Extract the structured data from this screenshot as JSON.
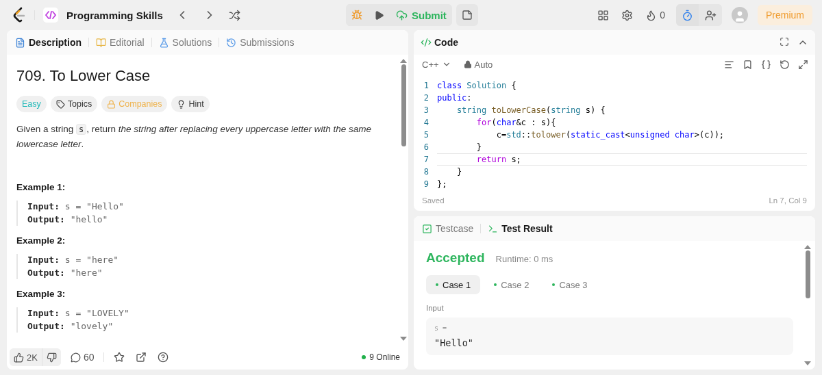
{
  "top_bar": {
    "title": "Programming Skills",
    "submit": "Submit",
    "streak": "0",
    "premium": "Premium",
    "timer_active": true
  },
  "description_panel": {
    "tabs": [
      {
        "label": "Description",
        "selected": true
      },
      {
        "label": "Editorial",
        "selected": false
      },
      {
        "label": "Solutions",
        "selected": false
      },
      {
        "label": "Submissions",
        "selected": false
      }
    ],
    "title": "709. To Lower Case",
    "tags": [
      {
        "kind": "easy",
        "label": "Easy"
      },
      {
        "kind": "tag",
        "label": "Topics"
      },
      {
        "kind": "locked",
        "label": "Companies"
      },
      {
        "kind": "hint",
        "label": "Hint"
      }
    ],
    "description": [
      {
        "kind": "text",
        "text": "Given a string "
      },
      {
        "kind": "code",
        "text": "s"
      },
      {
        "kind": "text",
        "text": ", return *the string after replacing every uppercase letter with the same lowercase letter*."
      }
    ],
    "examples": [
      {
        "title": "Example 1:",
        "lines": [
          {
            "label": "Input:",
            "value": "s = \"Hello\""
          },
          {
            "label": "Output:",
            "value": "\"hello\""
          }
        ]
      },
      {
        "title": "Example 2:",
        "lines": [
          {
            "label": "Input:",
            "value": "s = \"here\""
          },
          {
            "label": "Output:",
            "value": "\"here\""
          }
        ]
      },
      {
        "title": "Example 3:",
        "lines": [
          {
            "label": "Input:",
            "value": "s = \"LOVELY\""
          },
          {
            "label": "Output:",
            "value": "\"lovely\""
          }
        ]
      }
    ],
    "likes": "2K",
    "comments": "60",
    "online": "9 Online"
  },
  "code_panel": {
    "title": "Code",
    "language": "C++",
    "mode": "Auto",
    "lines": [
      {
        "number": "1",
        "current": false,
        "tokens": [
          {
            "kind": "keyword",
            "text": "class"
          },
          {
            "kind": "type",
            "text": " Solution"
          },
          {
            "kind": "plain",
            "text": " {"
          }
        ]
      },
      {
        "number": "2",
        "current": false,
        "tokens": [
          {
            "kind": "keyword",
            "text": "public"
          },
          {
            "kind": "plain",
            "text": ":"
          }
        ]
      },
      {
        "number": "3",
        "current": false,
        "tokens": [
          {
            "kind": "type",
            "text": "    string"
          },
          {
            "kind": "func",
            "text": " toLowerCase"
          },
          {
            "kind": "plain",
            "text": "("
          },
          {
            "kind": "type",
            "text": "string"
          },
          {
            "kind": "plain",
            "text": " s) {"
          }
        ]
      },
      {
        "number": "4",
        "current": false,
        "tokens": [
          {
            "kind": "control",
            "text": "        for"
          },
          {
            "kind": "plain",
            "text": "("
          },
          {
            "kind": "keyword",
            "text": "char"
          },
          {
            "kind": "plain",
            "text": "&c : s){"
          }
        ]
      },
      {
        "number": "5",
        "current": false,
        "tokens": [
          {
            "kind": "plain",
            "text": "            c="
          },
          {
            "kind": "type",
            "text": "std"
          },
          {
            "kind": "plain",
            "text": "::"
          },
          {
            "kind": "func",
            "text": "tolower"
          },
          {
            "kind": "plain",
            "text": "("
          },
          {
            "kind": "keyword",
            "text": "static_cast"
          },
          {
            "kind": "plain",
            "text": "<"
          },
          {
            "kind": "keyword",
            "text": "unsigned"
          },
          {
            "kind": "keyword",
            "text": " char"
          },
          {
            "kind": "plain",
            "text": ">(c));"
          }
        ]
      },
      {
        "number": "6",
        "current": false,
        "tokens": [
          {
            "kind": "plain",
            "text": "        }"
          }
        ]
      },
      {
        "number": "7",
        "current": true,
        "tokens": [
          {
            "kind": "control",
            "text": "        return"
          },
          {
            "kind": "plain",
            "text": " s;"
          }
        ]
      },
      {
        "number": "8",
        "current": false,
        "tokens": [
          {
            "kind": "plain",
            "text": "    }"
          }
        ]
      },
      {
        "number": "9",
        "current": false,
        "tokens": [
          {
            "kind": "plain",
            "text": "};"
          }
        ]
      }
    ],
    "status": "Saved",
    "cursor": "Ln 7, Col 9"
  },
  "result_panel": {
    "tabs": [
      {
        "label": "Testcase",
        "selected": false
      },
      {
        "label": "Test Result",
        "selected": true
      }
    ],
    "verdict": "Accepted",
    "runtime": "Runtime: 0 ms",
    "cases": [
      {
        "label": "Case 1",
        "selected": true
      },
      {
        "label": "Case 2",
        "selected": false
      },
      {
        "label": "Case 3",
        "selected": false
      }
    ],
    "input_heading": "Input",
    "variable": "s =",
    "value": "\"Hello\""
  }
}
